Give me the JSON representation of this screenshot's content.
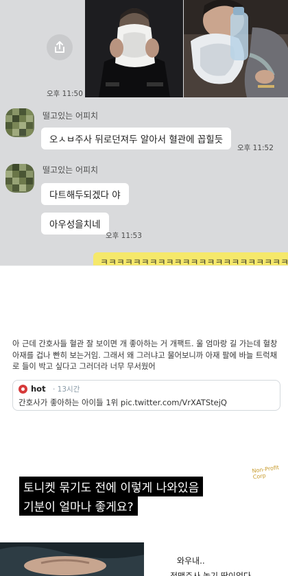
{
  "chat": {
    "photo_timestamp": "오후 11:50",
    "sender_name_1": "떨고있는 어피치",
    "message_1": "오ㅅㅂ주사 뒤로던져두 알아서 혈관에 꼽힐듯",
    "message_1_time": "오후 11:52",
    "sender_name_2": "떨고있는 어피치",
    "message_2": "다트해두되겠다 야",
    "message_3": "아우성을치네",
    "message_3_time": "오후 11:53",
    "my_message": "ㅋㅋㅋㅋㅋㅋㅋㅋㅋㅋㅋㅋㅋㅋㅋㅋㅋㅋㅋㅋㅋㅋㅋㅋ",
    "share_icon": "share-icon",
    "colors": {
      "bg": "#d9dadc",
      "bubble": "#ffffff",
      "my_bubble": "#f5e86a"
    }
  },
  "tweet": {
    "text": "아 근데 간호사들 혈관 잘 보이면 개 좋아하는 거 개팩트. 울 엄마랑 길 가는데 혈창 아재를 겁나 빤히 보는거임. 그래서 왜 그러냐고 물어보니까 아재 팔에 바늘 트럭채로 들이 박고 싶다고 그러더라 너무 무서웠어",
    "quote_name": "hot",
    "quote_time": "· 13시간",
    "quote_body": "간호사가 좋아하는 아이들 1위",
    "quote_url": "pic.twitter.com/VrXATStejQ"
  },
  "video": {
    "caption_1": "토니켓 묶기도 전에 이렇게 나와있음",
    "caption_2": "기분이 얼마나 좋게요?",
    "logo_text": "Non-Profit Corp",
    "side_text_1": "와우내..",
    "side_text_2": "정맥주사 놓기 딱이었다"
  }
}
